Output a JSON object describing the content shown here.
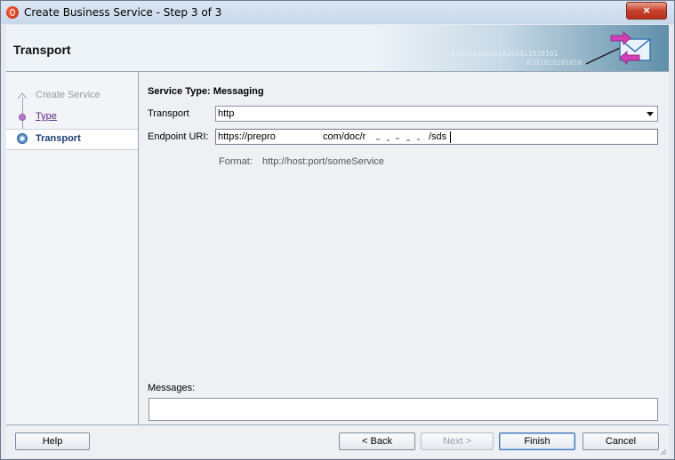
{
  "window": {
    "title": "Create Business Service - Step 3 of 3",
    "close_glyph": "×"
  },
  "header": {
    "title": "Transport",
    "binary_line1": "0101010101010101011010101",
    "binary_line2": "0101010101010"
  },
  "steps": {
    "items": [
      {
        "label": "Create Service",
        "state": "disabled"
      },
      {
        "label": "Type",
        "state": "link"
      },
      {
        "label": "Transport",
        "state": "current"
      }
    ]
  },
  "form": {
    "service_type": "Service Type: Messaging",
    "transport_label": "Transport",
    "transport_value": "http",
    "endpoint_label": "Endpoint URI:",
    "endpoint_seg1": "https://prepro",
    "endpoint_seg2": "com/doc/r",
    "endpoint_seg3": "/sds",
    "format_label": "Format:",
    "format_value": "http://host:port/someService",
    "messages_label": "Messages:"
  },
  "buttons": {
    "help": "Help",
    "back": "< Back",
    "next": "Next >",
    "finish": "Finish",
    "cancel": "Cancel"
  },
  "icons": {
    "app": "app-logo-icon",
    "close": "close-icon",
    "header": "envelope-arrows-icon",
    "dropdown": "chevron-down-icon"
  },
  "colors": {
    "accent": "#1c3f73",
    "link": "#5b2a86",
    "close": "#c8412a"
  }
}
